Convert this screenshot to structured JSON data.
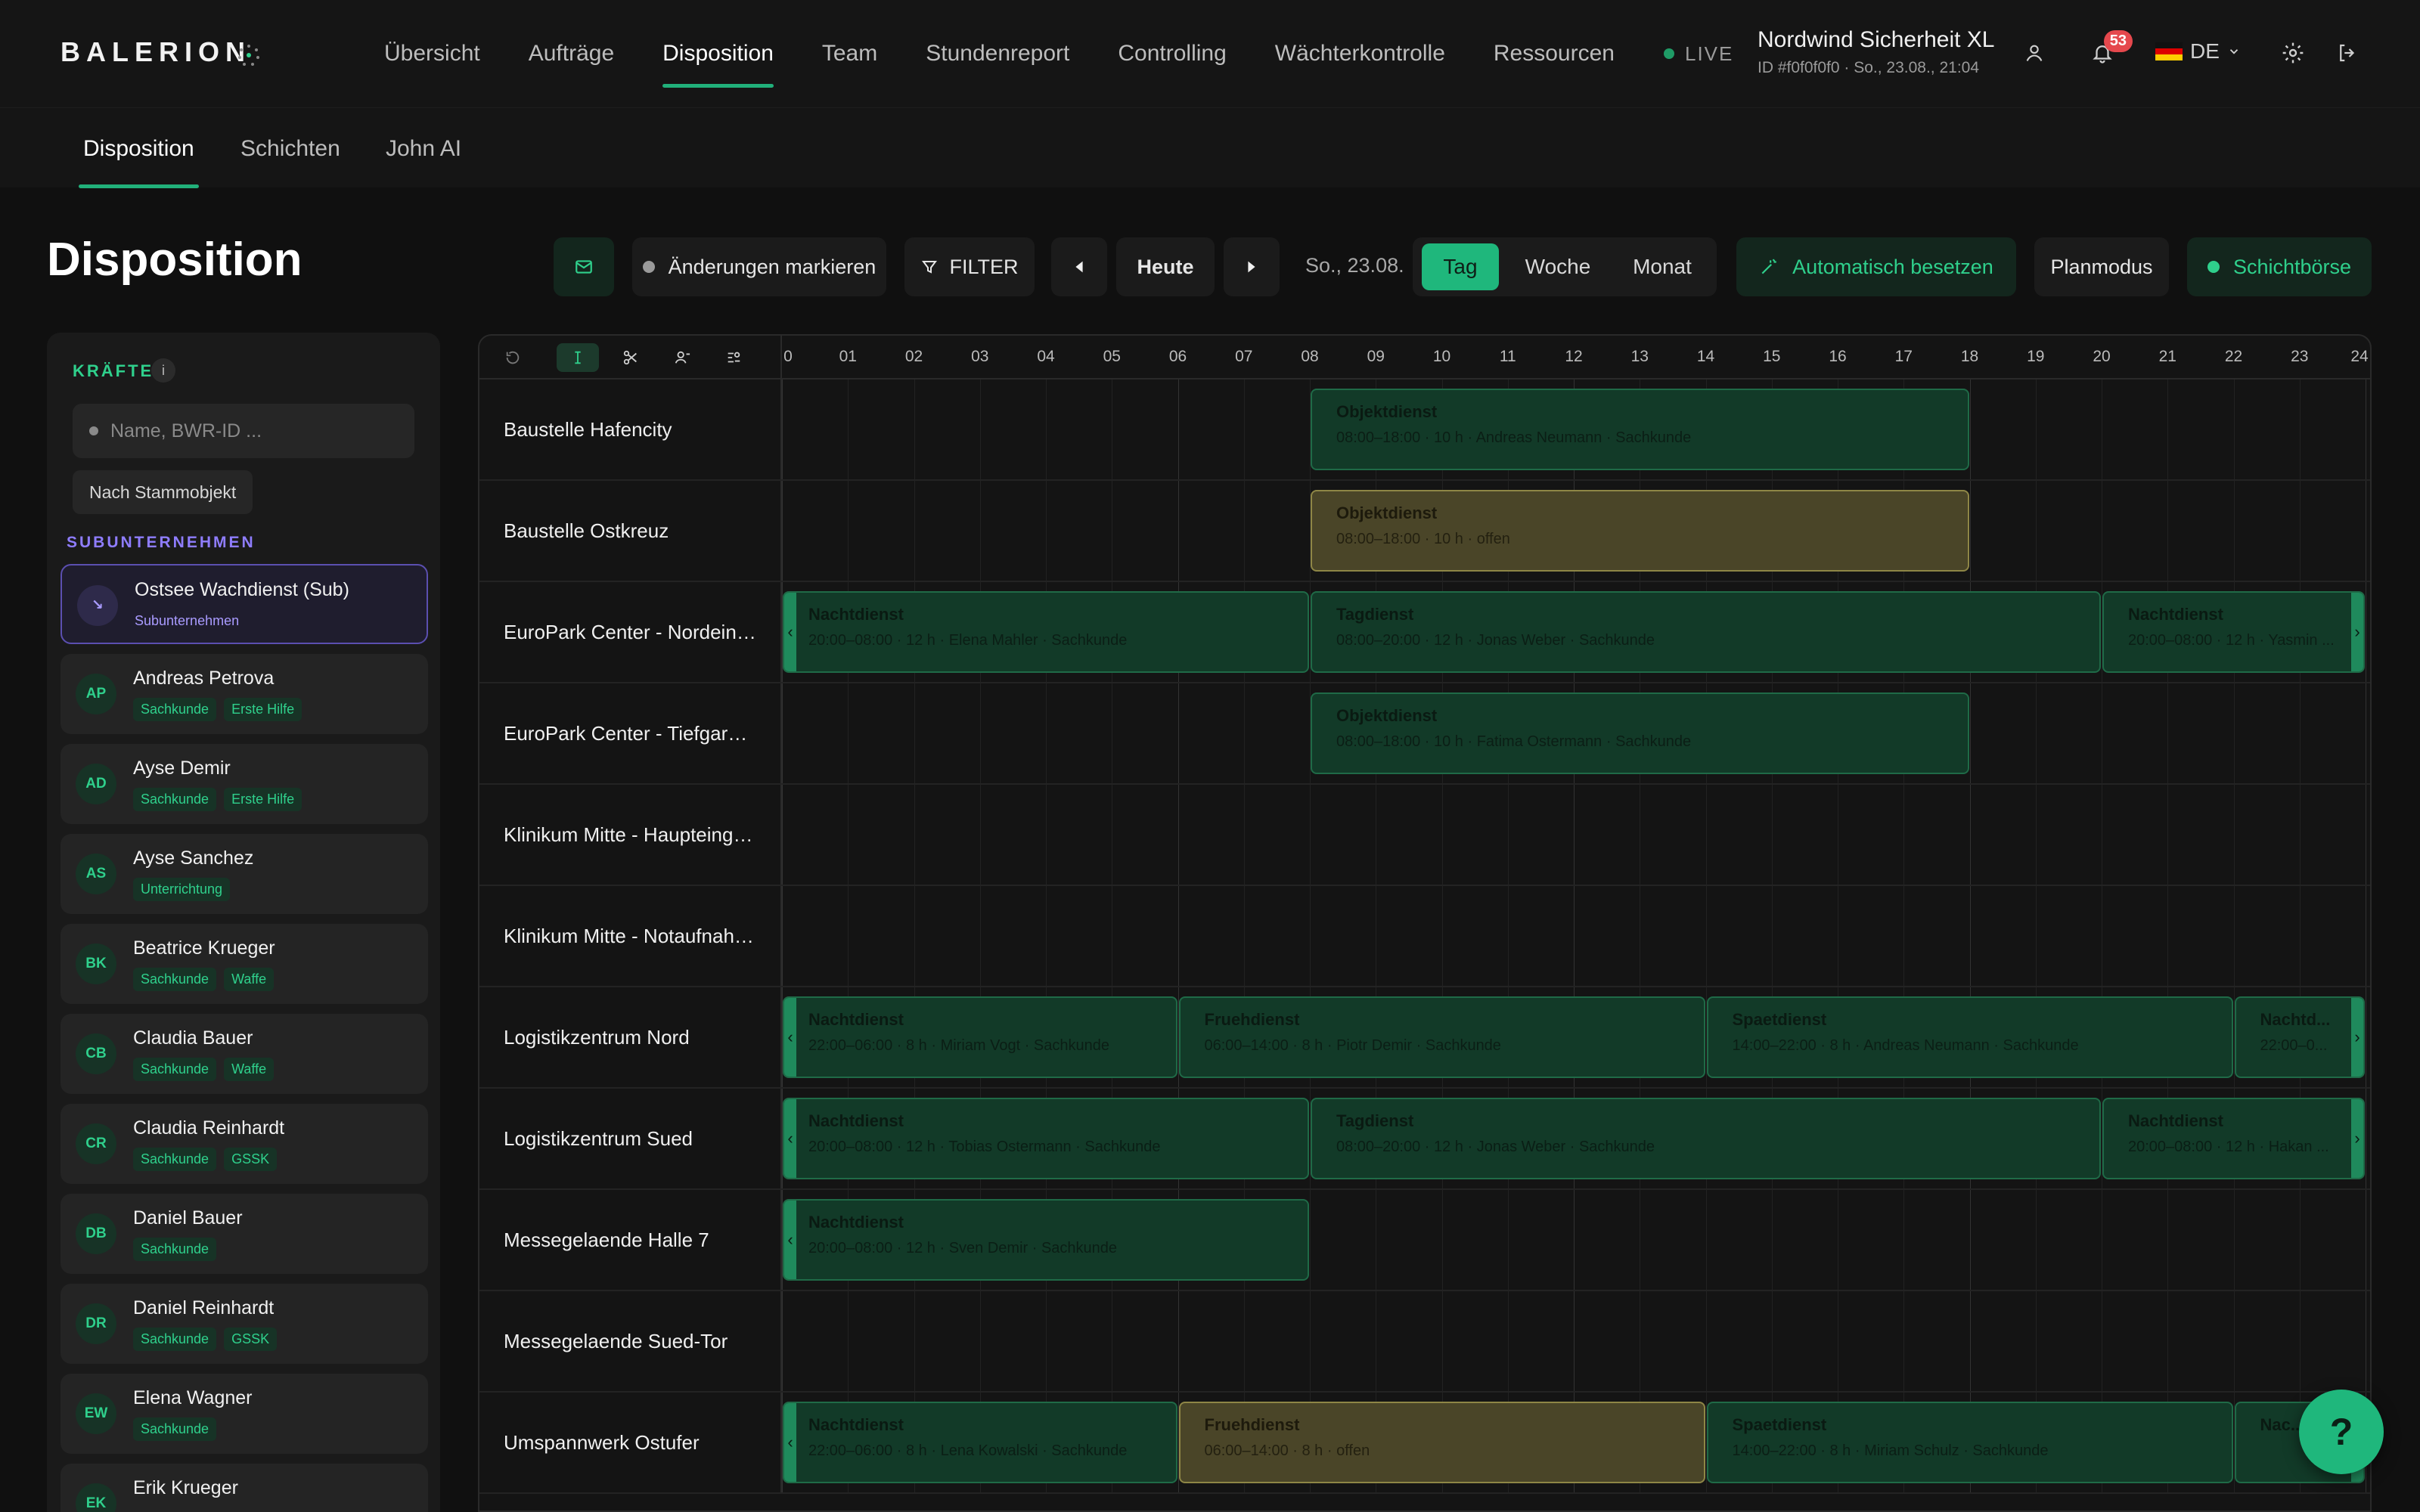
{
  "app": {
    "logo": "BALERION",
    "nav": [
      "Übersicht",
      "Aufträge",
      "Disposition",
      "Team",
      "Stundenreport",
      "Controlling",
      "Wächterkontrolle",
      "Ressourcen"
    ],
    "live_label": "LIVE",
    "tenant_name": "Nordwind Sicherheit XL",
    "tenant_sub": "ID #f0f0f0f0 · So., 23.08., 21:04",
    "notification_count": "53",
    "language": "DE"
  },
  "subnav": [
    "Disposition",
    "Schichten",
    "John AI"
  ],
  "header": {
    "title": "Disposition",
    "mark_changes": "Änderungen markieren",
    "filter": "FILTER",
    "today": "Heute",
    "date": "So., 23.08.",
    "views": [
      "Tag",
      "Woche",
      "Monat"
    ],
    "auto_assign": "Automatisch besetzen",
    "plan_mode": "Planmodus",
    "shift_exchange": "Schichtbörse"
  },
  "panel": {
    "title": "KRÄFTE",
    "search_placeholder": "Name, BWR-ID ...",
    "group_button": "Nach Stammobjekt",
    "sub_section": "SUBUNTERNEHMEN",
    "sub_worker": {
      "initials": "↘",
      "name": "Ostsee Wachdienst (Sub)",
      "tag": "Subunternehmen"
    },
    "workers": [
      {
        "initials": "AP",
        "name": "Andreas Petrova",
        "tags": [
          "Sachkunde",
          "Erste Hilfe"
        ]
      },
      {
        "initials": "AD",
        "name": "Ayse Demir",
        "tags": [
          "Sachkunde",
          "Erste Hilfe"
        ]
      },
      {
        "initials": "AS",
        "name": "Ayse Sanchez",
        "tags": [
          "Unterrichtung"
        ]
      },
      {
        "initials": "BK",
        "name": "Beatrice Krueger",
        "tags": [
          "Sachkunde",
          "Waffe"
        ]
      },
      {
        "initials": "CB",
        "name": "Claudia Bauer",
        "tags": [
          "Sachkunde",
          "Waffe"
        ]
      },
      {
        "initials": "CR",
        "name": "Claudia Reinhardt",
        "tags": [
          "Sachkunde",
          "GSSK"
        ]
      },
      {
        "initials": "DB",
        "name": "Daniel Bauer",
        "tags": [
          "Sachkunde"
        ]
      },
      {
        "initials": "DR",
        "name": "Daniel Reinhardt",
        "tags": [
          "Sachkunde",
          "GSSK"
        ]
      },
      {
        "initials": "EW",
        "name": "Elena Wagner",
        "tags": [
          "Sachkunde"
        ]
      },
      {
        "initials": "EK",
        "name": "Erik Krueger",
        "tags": []
      }
    ]
  },
  "planner": {
    "hours": [
      "0",
      "01",
      "02",
      "03",
      "04",
      "05",
      "06",
      "07",
      "08",
      "09",
      "10",
      "11",
      "12",
      "13",
      "14",
      "15",
      "16",
      "17",
      "18",
      "19",
      "20",
      "21",
      "22",
      "23",
      "24"
    ],
    "rows": [
      {
        "name": "Baustelle Hafencity",
        "shifts": [
          {
            "start": 8,
            "end": 18,
            "title": "Objektdienst",
            "sub": "08:00–18:00 · 10 h · Andreas Neumann · Sachkunde",
            "open": false
          }
        ]
      },
      {
        "name": "Baustelle Ostkreuz",
        "shifts": [
          {
            "start": 8,
            "end": 18,
            "title": "Objektdienst",
            "sub": "08:00–18:00 · 10 h · offen",
            "open": true
          }
        ]
      },
      {
        "name": "EuroPark Center - Nordeingang",
        "shifts": [
          {
            "start": 0,
            "end": 8,
            "title": "Nachtdienst",
            "sub": "20:00–08:00 · 12 h · Elena Mahler · Sachkunde",
            "open": false,
            "cl": true
          },
          {
            "start": 8,
            "end": 20,
            "title": "Tagdienst",
            "sub": "08:00–20:00 · 12 h · Jonas Weber · Sachkunde",
            "open": false
          },
          {
            "start": 20,
            "end": 24,
            "title": "Nachtdienst",
            "sub": "20:00–08:00 · 12 h · Yasmin ...",
            "open": false,
            "cr": true
          }
        ]
      },
      {
        "name": "EuroPark Center - Tiefgarage",
        "shifts": [
          {
            "start": 8,
            "end": 18,
            "title": "Objektdienst",
            "sub": "08:00–18:00 · 10 h · Fatima Ostermann · Sachkunde",
            "open": false
          }
        ]
      },
      {
        "name": "Klinikum Mitte - Haupteingang",
        "shifts": []
      },
      {
        "name": "Klinikum Mitte - Notaufnahme",
        "shifts": []
      },
      {
        "name": "Logistikzentrum Nord",
        "shifts": [
          {
            "start": 0,
            "end": 6,
            "title": "Nachtdienst",
            "sub": "22:00–06:00 · 8 h · Miriam Vogt · Sachkunde",
            "open": false,
            "cl": true
          },
          {
            "start": 6,
            "end": 14,
            "title": "Fruehdienst",
            "sub": "06:00–14:00 · 8 h · Piotr Demir · Sachkunde",
            "open": false
          },
          {
            "start": 14,
            "end": 22,
            "title": "Spaetdienst",
            "sub": "14:00–22:00 · 8 h · Andreas Neumann · Sachkunde",
            "open": false
          },
          {
            "start": 22,
            "end": 24,
            "title": "Nachtd...",
            "sub": "22:00–0...",
            "open": false,
            "cr": true
          }
        ]
      },
      {
        "name": "Logistikzentrum Sued",
        "shifts": [
          {
            "start": 0,
            "end": 8,
            "title": "Nachtdienst",
            "sub": "20:00–08:00 · 12 h · Tobias Ostermann · Sachkunde",
            "open": false,
            "cl": true
          },
          {
            "start": 8,
            "end": 20,
            "title": "Tagdienst",
            "sub": "08:00–20:00 · 12 h · Jonas Weber · Sachkunde",
            "open": false
          },
          {
            "start": 20,
            "end": 24,
            "title": "Nachtdienst",
            "sub": "20:00–08:00 · 12 h · Hakan ...",
            "open": false,
            "cr": true
          }
        ]
      },
      {
        "name": "Messegelaende Halle 7",
        "shifts": [
          {
            "start": 0,
            "end": 8,
            "title": "Nachtdienst",
            "sub": "20:00–08:00 · 12 h · Sven Demir · Sachkunde",
            "open": false,
            "cl": true
          }
        ]
      },
      {
        "name": "Messegelaende Sued-Tor",
        "shifts": []
      },
      {
        "name": "Umspannwerk Ostufer",
        "shifts": [
          {
            "start": 0,
            "end": 6,
            "title": "Nachtdienst",
            "sub": "22:00–06:00 · 8 h · Lena Kowalski · Sachkunde",
            "open": false,
            "cl": true
          },
          {
            "start": 6,
            "end": 14,
            "title": "Fruehdienst",
            "sub": "06:00–14:00 · 8 h · offen",
            "open": true
          },
          {
            "start": 14,
            "end": 22,
            "title": "Spaetdienst",
            "sub": "14:00–22:00 · 8 h · Miriam Schulz · Sachkunde",
            "open": false
          },
          {
            "start": 22,
            "end": 24,
            "title": "Nac...",
            "sub": "",
            "open": false,
            "cr": true
          }
        ]
      }
    ]
  },
  "help": "?"
}
